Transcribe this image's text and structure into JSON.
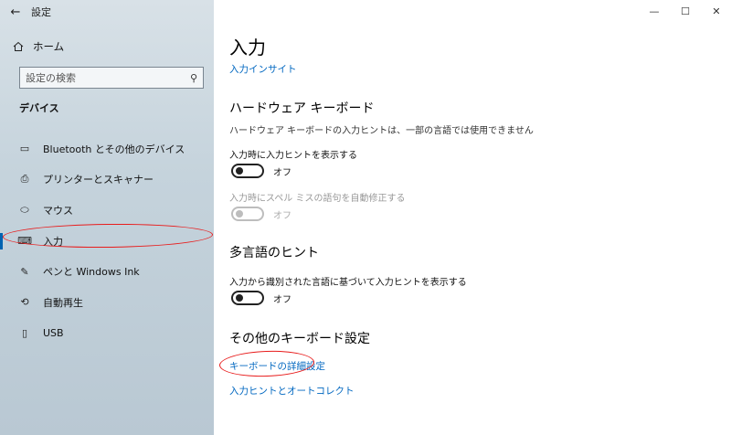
{
  "window": {
    "app_title": "設定",
    "back_glyph": "←",
    "controls": {
      "minimize": "—",
      "maximize": "☐",
      "close": "✕"
    }
  },
  "sidebar": {
    "home_label": "ホーム",
    "search_placeholder": "設定の検索",
    "section_heading": "デバイス",
    "items": [
      {
        "label": "Bluetooth とその他のデバイス",
        "icon": "bluetooth-devices-icon",
        "glyph": "▭"
      },
      {
        "label": "プリンターとスキャナー",
        "icon": "printer-icon",
        "glyph": "⎙"
      },
      {
        "label": "マウス",
        "icon": "mouse-icon",
        "glyph": "⬭"
      },
      {
        "label": "入力",
        "icon": "keyboard-icon",
        "glyph": "⌨"
      },
      {
        "label": "ペンと Windows Ink",
        "icon": "pen-icon",
        "glyph": "✎"
      },
      {
        "label": "自動再生",
        "icon": "autoplay-icon",
        "glyph": "⟲"
      },
      {
        "label": "USB",
        "icon": "usb-icon",
        "glyph": "▯"
      }
    ],
    "active_index": 3
  },
  "main": {
    "title": "入力",
    "insight_link": "入力インサイト",
    "hardware_keyboard": {
      "heading": "ハードウェア キーボード",
      "description": "ハードウェア キーボードの入力ヒントは、一部の言語では使用できません",
      "setting1": {
        "label": "入力時に入力ヒントを表示する",
        "state": "オフ",
        "enabled": true
      },
      "setting2": {
        "label": "入力時にスペル ミスの語句を自動修正する",
        "state": "オフ",
        "enabled": false
      }
    },
    "multilingual": {
      "heading": "多言語のヒント",
      "setting": {
        "label": "入力から識別された言語に基づいて入力ヒントを表示する",
        "state": "オフ"
      }
    },
    "other_keyboard": {
      "heading": "その他のキーボード設定",
      "link_advanced": "キーボードの詳細設定",
      "link_autocorrect": "入力ヒントとオートコレクト"
    }
  },
  "colors": {
    "accent": "#0067c0",
    "annotation": "#e81c1c",
    "sidebar_bg": "#c5d3dc"
  }
}
